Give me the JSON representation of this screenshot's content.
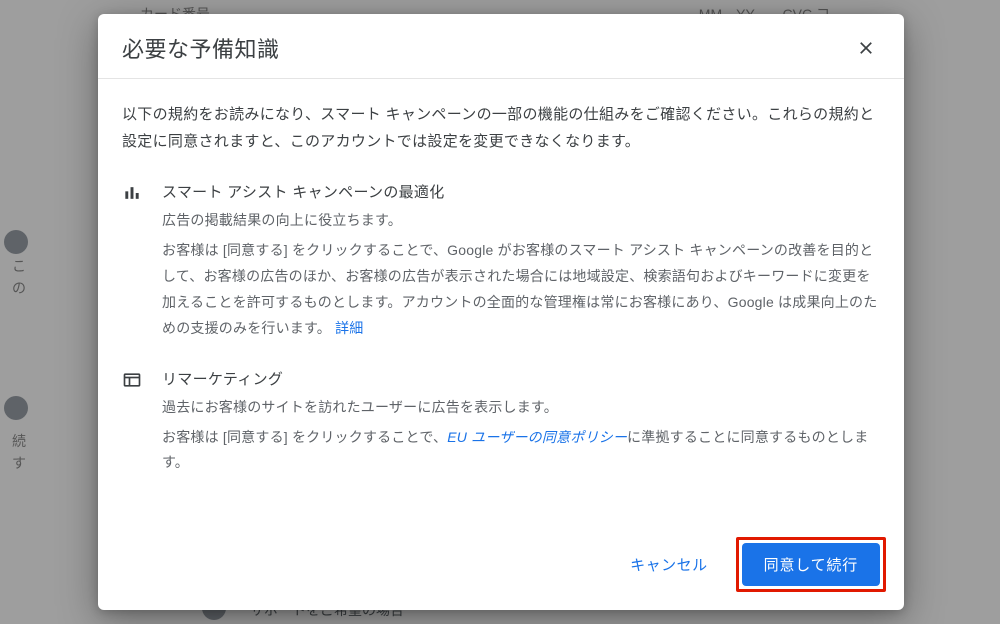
{
  "bg": {
    "top_left": "カード番号",
    "top_right": "MM　YY　　CVC コ",
    "side1a": "こ",
    "side1b": "の",
    "side2a": "続",
    "side2b": "す",
    "bottom": "サポートをご希望の場合"
  },
  "modal": {
    "title": "必要な予備知識",
    "intro": "以下の規約をお読みになり、スマート キャンペーンの一部の機能の仕組みをご確認ください。これらの規約と設定に同意されますと、このアカウントでは設定を変更できなくなります。",
    "section1": {
      "title": "スマート アシスト キャンペーンの最適化",
      "sub": "広告の掲載結果の向上に役立ちます。",
      "body": "お客様は [同意する] をクリックすることで、Google がお客様のスマート アシスト キャンペーンの改善を目的として、お客様の広告のほか、お客様の広告が表示された場合には地域設定、検索語句およびキーワードに変更を加えることを許可するものとします。アカウントの全面的な管理権は常にお客様にあり、Google は成果向上のための支援のみを行います。",
      "link": "詳細"
    },
    "section2": {
      "title": "リマーケティング",
      "sub": "過去にお客様のサイトを訪れたユーザーに広告を表示します。",
      "body_before": "お客様は [同意する] をクリックすることで、",
      "body_link": "EU ユーザーの同意ポリシー",
      "body_after": "に準拠することに同意するものとします。"
    },
    "buttons": {
      "cancel": "キャンセル",
      "agree": "同意して続行"
    }
  }
}
